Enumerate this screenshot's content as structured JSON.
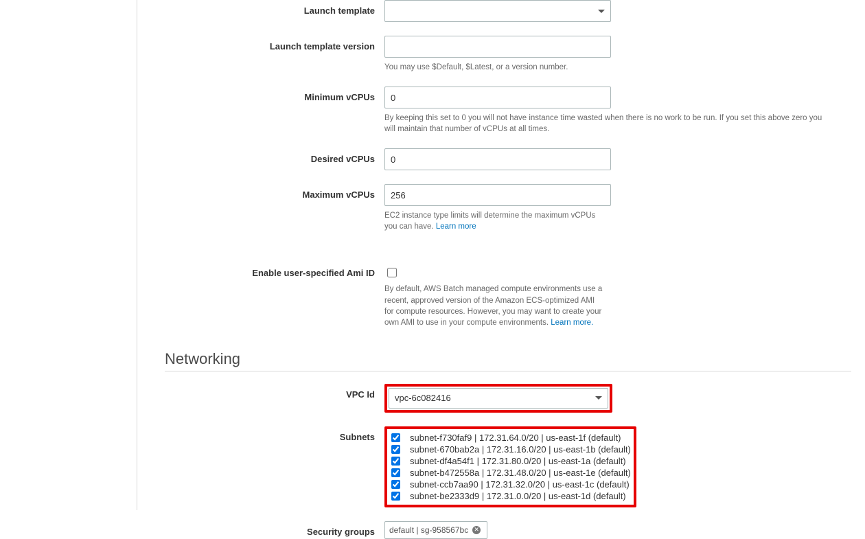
{
  "fields": {
    "launch_template": {
      "label": "Launch template",
      "value": ""
    },
    "launch_template_version": {
      "label": "Launch template version",
      "value": "",
      "help": "You may use $Default, $Latest, or a version number."
    },
    "min_vcpus": {
      "label": "Minimum vCPUs",
      "value": "0",
      "help": "By keeping this set to 0 you will not have instance time wasted when there is no work to be run. If you set this above zero you will maintain that number of vCPUs at all times."
    },
    "desired_vcpus": {
      "label": "Desired vCPUs",
      "value": "0"
    },
    "max_vcpus": {
      "label": "Maximum vCPUs",
      "value": "256",
      "help": "EC2 instance type limits will determine the maximum vCPUs you can have. ",
      "learn_more": "Learn more"
    },
    "enable_ami": {
      "label": "Enable user-specified Ami ID",
      "checked": false,
      "help": "By default, AWS Batch managed compute environments use a recent, approved version of the Amazon ECS-optimized AMI for compute resources. However, you may want to create your own AMI to use in your compute environments. ",
      "learn_more": "Learn more."
    }
  },
  "networking": {
    "heading": "Networking",
    "vpc": {
      "label": "VPC Id",
      "value": "vpc-6c082416"
    },
    "subnets": {
      "label": "Subnets",
      "items": [
        {
          "checked": true,
          "text": "subnet-f730faf9 | 172.31.64.0/20 | us-east-1f (default)"
        },
        {
          "checked": true,
          "text": "subnet-670bab2a | 172.31.16.0/20 | us-east-1b (default)"
        },
        {
          "checked": true,
          "text": "subnet-df4a54f1 | 172.31.80.0/20 | us-east-1a (default)"
        },
        {
          "checked": true,
          "text": "subnet-b472558a | 172.31.48.0/20 | us-east-1e (default)"
        },
        {
          "checked": true,
          "text": "subnet-ccb7aa90 | 172.31.32.0/20 | us-east-1c (default)"
        },
        {
          "checked": true,
          "text": "subnet-be2333d9 | 172.31.0.0/20 | us-east-1d (default)"
        }
      ]
    },
    "security_groups": {
      "label": "Security groups",
      "value": "default | sg-958567bc"
    }
  }
}
